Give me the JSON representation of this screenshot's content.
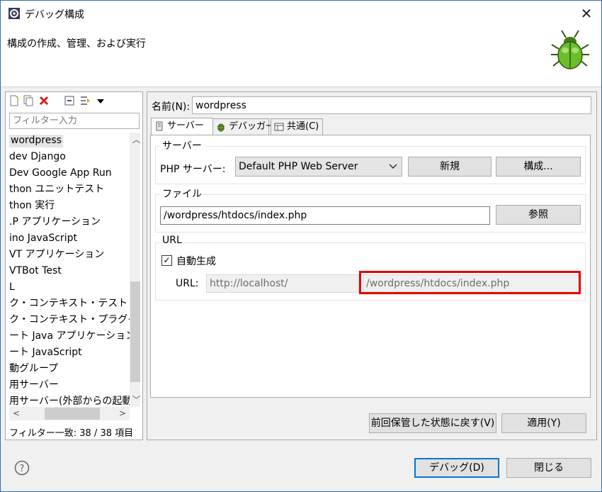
{
  "window": {
    "title": "デバッグ構成",
    "close_label": "✕",
    "banner_text": "構成の作成、管理、および実行"
  },
  "sidebar": {
    "filter_placeholder": "フィルター入力",
    "items": [
      {
        "label": "wordpress",
        "selected": true
      },
      {
        "label": "dev Django"
      },
      {
        "label": "Dev Google App Run"
      },
      {
        "label": "thon ユニットテスト"
      },
      {
        "label": "thon 実行"
      },
      {
        "label": ".P アプリケーション"
      },
      {
        "label": "ino JavaScript"
      },
      {
        "label": "VT アプリケーション"
      },
      {
        "label": "VTBot Test"
      },
      {
        "label": "L"
      },
      {
        "label": "ク・コンテキスト・テスト"
      },
      {
        "label": "ク・コンテキスト・プラグイン・テ"
      },
      {
        "label": "ート Java アプリケーション"
      },
      {
        "label": "ート JavaScript"
      },
      {
        "label": "動グループ"
      },
      {
        "label": "用サーバー"
      },
      {
        "label": "用サーバー(外部からの起動)"
      }
    ],
    "filter_status": "フィルター一致: 38 / 38 項目",
    "scroll_up": "︿",
    "scroll_down": "﹀",
    "scroll_left": "<",
    "scroll_right": ">"
  },
  "main": {
    "name_label": "名前(N):",
    "name_value": "wordpress",
    "tabs": [
      {
        "label": "サーバー",
        "icon": "server-icon",
        "active": true
      },
      {
        "label": "デバッガー",
        "icon": "bug-icon"
      },
      {
        "label": "共通(C)",
        "icon": "common-icon"
      }
    ],
    "server_group": {
      "title": "サーバー",
      "php_server_label": "PHP サーバー:",
      "php_server_value": "Default PHP Web Server",
      "new_button": "新規",
      "configure_button": "構成..."
    },
    "file_group": {
      "title": "ファイル",
      "file_value": "/wordpress/htdocs/index.php",
      "browse_button": "参照"
    },
    "url_group": {
      "title": "URL",
      "auto_generate_label": "自動生成",
      "auto_generate_checked": true,
      "url_label": "URL:",
      "url_base": "http://localhost/",
      "url_path": "/wordpress/htdocs/index.php",
      "highlight_color": "#e30000"
    },
    "revert_button": "前回保管した状態に戻す(V)",
    "apply_button": "適用(Y)"
  },
  "footer": {
    "help_icon": "help-icon",
    "debug_button": "デバッグ(D)",
    "close_button": "閉じる"
  }
}
